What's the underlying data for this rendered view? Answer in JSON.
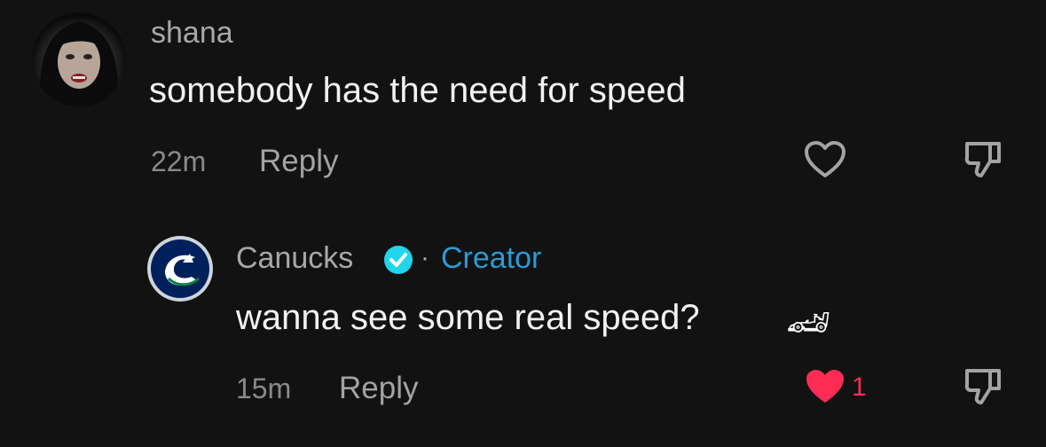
{
  "comments": [
    {
      "username": "shana",
      "text": "somebody has the need for speed",
      "time": "22m",
      "reply_label": "Reply",
      "liked": false,
      "icons": {
        "like": "heart-outline-icon",
        "dislike": "thumbs-down-icon"
      }
    },
    {
      "username": "Canucks",
      "verified": true,
      "separator": "·",
      "role": "Creator",
      "text": "wanna see some real speed?",
      "emoji": "🏎",
      "time": "15m",
      "reply_label": "Reply",
      "liked": true,
      "like_count": "1",
      "icons": {
        "like": "heart-filled-icon",
        "dislike": "thumbs-down-icon",
        "verified": "verified-check-icon"
      }
    }
  ],
  "colors": {
    "background": "#121212",
    "creator": "#2b9bd6",
    "verified": "#20d5ec",
    "liked_heart": "#fe2c55"
  }
}
